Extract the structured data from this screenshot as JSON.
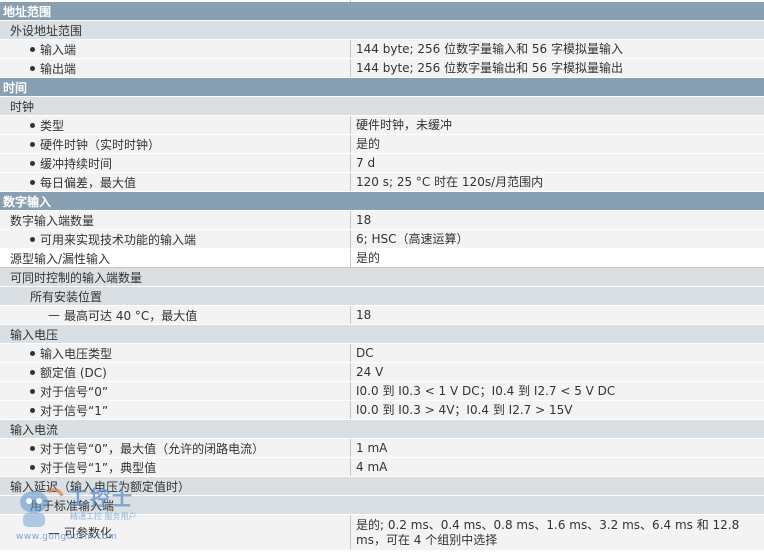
{
  "sections": {
    "address": {
      "title": "地址范围",
      "sub": "外设地址范围",
      "rows": [
        {
          "label": "输入端",
          "value": "144 byte; 256 位数字量输入和 56 字模拟量输入"
        },
        {
          "label": "输出端",
          "value": "144 byte; 256 位数字量输出和 56 字模拟量输出"
        }
      ]
    },
    "time": {
      "title": "时间",
      "sub": "时钟",
      "rows": [
        {
          "label": "类型",
          "value": "硬件时钟，未缓冲"
        },
        {
          "label": "硬件时钟（实时时钟）",
          "value": "是的"
        },
        {
          "label": "缓冲持续时间",
          "value": "7 d"
        },
        {
          "label": "每日偏差，最大值",
          "value": "120 s; 25 °C 时在 120s/月范围内"
        }
      ]
    },
    "digital_input": {
      "title": "数字输入",
      "count_label": "数字输入端数量",
      "count_value": "18",
      "tech_label": "可用来实现技术功能的输入端",
      "tech_value": "6; HSC（高速运算）",
      "source_label": "源型输入/漏性输入",
      "source_value": "是的",
      "simul_title": "可同时控制的输入端数量",
      "all_positions": "所有安装位置",
      "max40_label": "最高可达 40 °C，最大值",
      "max40_value": "18",
      "voltage_title": "输入电压",
      "voltage_rows": [
        {
          "label": "输入电压类型",
          "value": "DC"
        },
        {
          "label": "额定值 (DC)",
          "value": "24 V"
        },
        {
          "label": "对于信号“0”",
          "value": "I0.0 到 I0.3 < 1 V DC；I0.4 到 I2.7 < 5 V DC"
        },
        {
          "label": "对于信号“1”",
          "value": "I0.0 到 I0.3 > 4V；I0.4 到 I2.7 > 15V"
        }
      ],
      "current_title": "输入电流",
      "current_rows": [
        {
          "label": "对于信号“0”，最大值（允许的闭路电流）",
          "value": "1 mA"
        },
        {
          "label": "对于信号“1”，典型值",
          "value": "4 mA"
        }
      ],
      "delay_title": "输入延迟（输入电压为额定值时）",
      "std_inputs": "用于标准输入端",
      "param_label": "可参数化",
      "param_value": "是的; 0.2 ms、0.4 ms、0.8 ms、1.6 ms、3.2 ms、6.4 ms 和 12.8 ms，可在 4 个组别中选择"
    }
  },
  "watermark": {
    "brand": "工控士",
    "tagline": "精通工控 服务用户",
    "url": "www.gongboshi.com"
  }
}
